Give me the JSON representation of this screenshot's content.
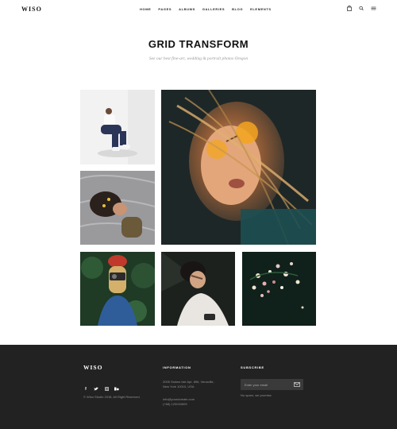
{
  "header": {
    "logo": "WISO",
    "nav": [
      "HOME",
      "PAGES",
      "ALBUMS",
      "GALLERIES",
      "BLOG",
      "ELEMENTS"
    ],
    "icons": [
      "shopping-bag-icon",
      "search-icon",
      "menu-icon"
    ]
  },
  "hero": {
    "title": "GRID TRANSFORM",
    "subtitle": "See our best fine-art, wedding & portrait photos Oregon"
  },
  "gallery": {
    "photos": [
      "photo-sitting-person-white-room",
      "photo-woman-glasses-windblown-hair",
      "photo-girl-lying-on-rug",
      "photo-girl-red-beanie-camera",
      "photo-woman-lying-hand-shadow",
      "photo-flowers-dark-water"
    ]
  },
  "footer": {
    "logo": "WISO",
    "social": [
      "facebook-icon",
      "twitter-icon",
      "instagram-icon",
      "behance-icon"
    ],
    "copyright": "© Wiso Studio 2018, All Right Reserved.",
    "information": {
      "heading": "INFORMATION",
      "address_line1": "2005 Stokes Isle Apt. 896, Venaville,",
      "address_line2": "New York 10010, USA",
      "email": "info@yourdomain.com",
      "phone": "(+68) 120034509"
    },
    "subscribe": {
      "heading": "SUBSCRIBE",
      "placeholder": "Enter your email",
      "note": "No spam, we promise."
    }
  },
  "colors": {
    "footer_bg": "#222222",
    "accent": "#111111"
  }
}
